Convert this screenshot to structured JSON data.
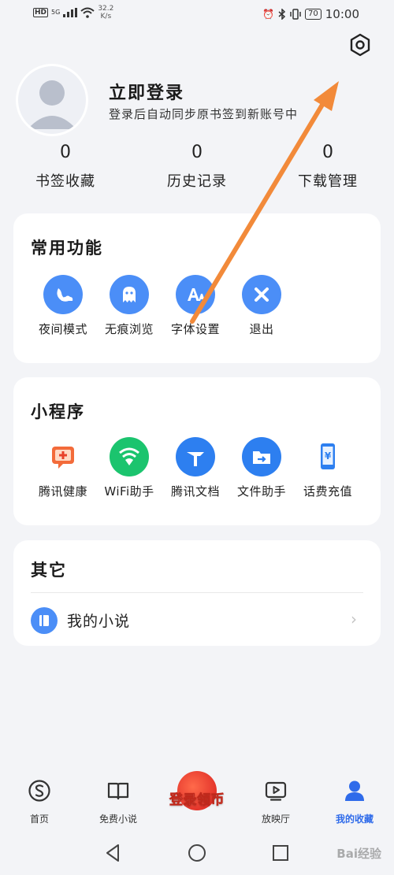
{
  "status_bar": {
    "hd": "HD",
    "network": "5G",
    "speed_value": "32.2",
    "speed_unit": "K/s",
    "battery": "70",
    "time": "10:00"
  },
  "header": {
    "settings_icon": "hexagon-settings-icon"
  },
  "profile": {
    "title": "立即登录",
    "subtitle": "登录后自动同步原书签到新账号中",
    "stats": [
      {
        "value": "0",
        "label": "书签收藏"
      },
      {
        "value": "0",
        "label": "历史记录"
      },
      {
        "value": "0",
        "label": "下载管理"
      }
    ]
  },
  "common_functions": {
    "title": "常用功能",
    "items": [
      {
        "label": "夜间模式",
        "icon": "night-mode-icon"
      },
      {
        "label": "无痕浏览",
        "icon": "ghost-icon"
      },
      {
        "label": "字体设置",
        "icon": "font-icon"
      },
      {
        "label": "退出",
        "icon": "close-icon"
      }
    ]
  },
  "mini_programs": {
    "title": "小程序",
    "items": [
      {
        "label": "腾讯健康",
        "icon": "health-icon"
      },
      {
        "label": "WiFi助手",
        "icon": "wifi-shield-icon"
      },
      {
        "label": "腾讯文档",
        "icon": "docs-icon"
      },
      {
        "label": "文件助手",
        "icon": "folder-icon"
      },
      {
        "label": "话费充值",
        "icon": "phone-recharge-icon"
      }
    ]
  },
  "others": {
    "title": "其它",
    "items": [
      {
        "label": "我的小说",
        "icon": "book-icon"
      }
    ]
  },
  "bottom_nav": {
    "items": [
      {
        "label": "首页",
        "icon": "home-s-icon"
      },
      {
        "label": "免费小说",
        "icon": "open-book-icon"
      },
      {
        "label": "放映厅",
        "icon": "video-play-icon"
      },
      {
        "label": "我的收藏",
        "icon": "user-icon",
        "active": true
      }
    ],
    "promo": "登录领币"
  },
  "watermark": "Bai经验",
  "colors": {
    "accent_blue": "#4b8ef7",
    "active_nav": "#2f6bea",
    "annotation_arrow": "#f28a3a",
    "background": "#f3f4f7"
  }
}
